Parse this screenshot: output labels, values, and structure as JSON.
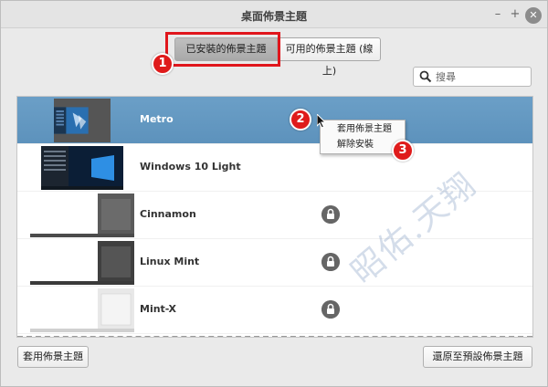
{
  "window": {
    "title": "桌面佈景主題",
    "controls": {
      "minimize": "–",
      "maximize": "+",
      "close": "✕"
    }
  },
  "tabs": [
    {
      "label": "已安裝的佈景主題",
      "selected": true
    },
    {
      "label": "可用的佈景主題 (線上)",
      "selected": false
    }
  ],
  "search": {
    "placeholder": "搜尋",
    "icon": "search-icon"
  },
  "themes": [
    {
      "name": "Metro",
      "selected": true,
      "locked": false
    },
    {
      "name": "Windows 10 Light",
      "selected": false,
      "locked": false
    },
    {
      "name": "Cinnamon",
      "selected": false,
      "locked": true
    },
    {
      "name": "Linux Mint",
      "selected": false,
      "locked": true
    },
    {
      "name": "Mint-X",
      "selected": false,
      "locked": true
    }
  ],
  "context_menu": {
    "items": [
      {
        "label": "套用佈景主題"
      },
      {
        "label": "解除安裝"
      }
    ]
  },
  "annotations": [
    "1",
    "2",
    "3"
  ],
  "buttons": {
    "apply": "套用佈景主題",
    "restore": "還原至預設佈景主題"
  },
  "watermark": "昭佑.天翔",
  "colors": {
    "selection": "#6b9fc7",
    "annotation_red": "#df1b1b"
  }
}
